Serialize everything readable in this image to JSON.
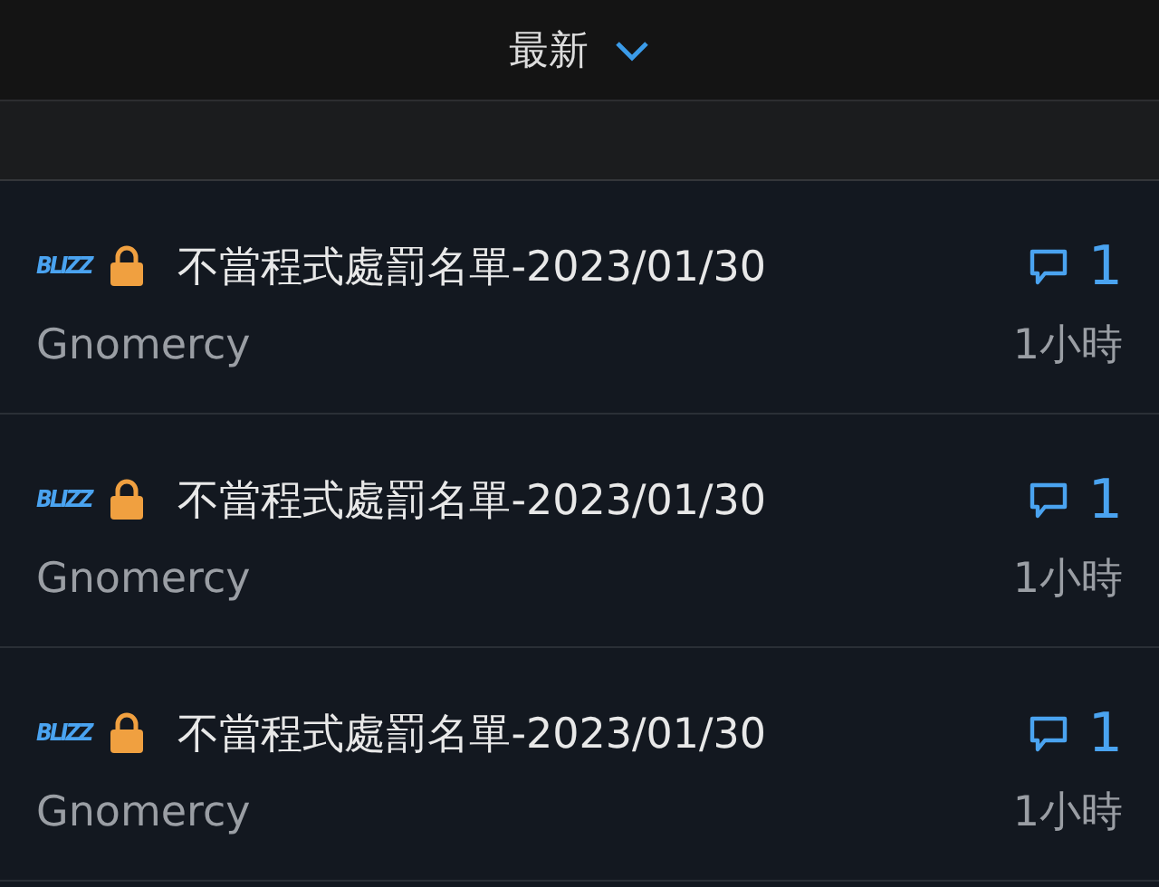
{
  "sort": {
    "label": "最新",
    "expanded": false
  },
  "threads": [
    {
      "badge": "BLIZZ",
      "locked": true,
      "title": "不當程式處罰名單-2023/01/30",
      "author": "Gnomercy",
      "replies": "1",
      "time": "1小時"
    },
    {
      "badge": "BLIZZ",
      "locked": true,
      "title": "不當程式處罰名單-2023/01/30",
      "author": "Gnomercy",
      "replies": "1",
      "time": "1小時"
    },
    {
      "badge": "BLIZZ",
      "locked": true,
      "title": "不當程式處罰名單-2023/01/30",
      "author": "Gnomercy",
      "replies": "1",
      "time": "1小時"
    }
  ]
}
